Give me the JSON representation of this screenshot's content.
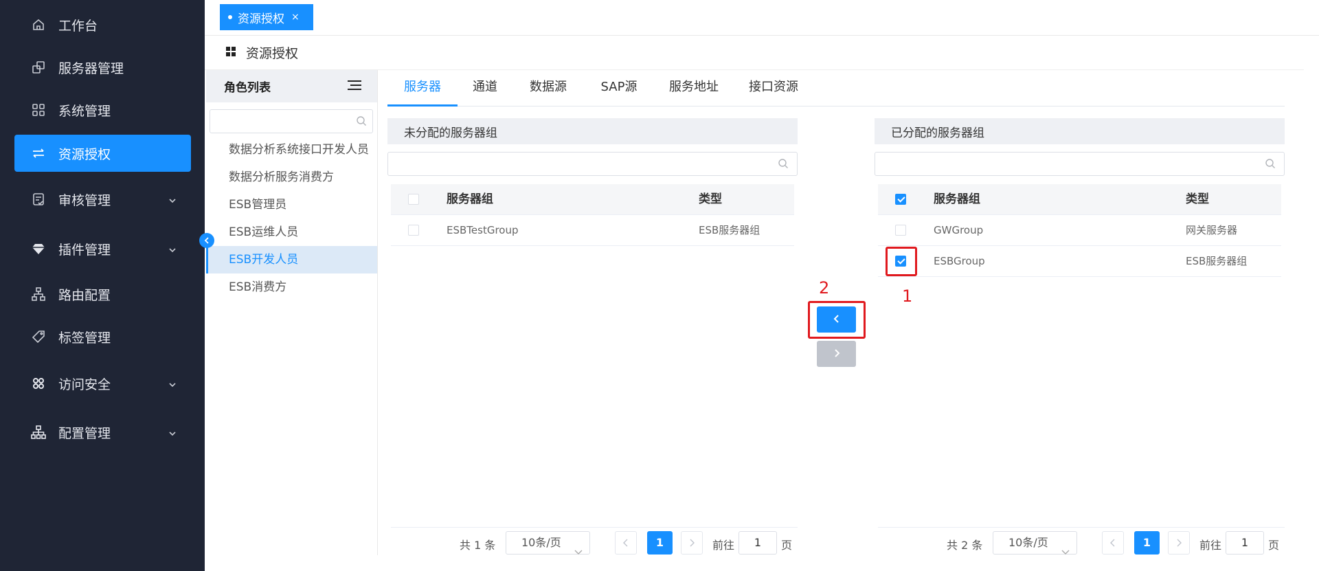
{
  "sidebar": {
    "items": [
      {
        "label": "工作台",
        "icon": "home-icon",
        "has_arrow": false,
        "active": false
      },
      {
        "label": "服务器管理",
        "icon": "server-icon",
        "has_arrow": false,
        "active": false
      },
      {
        "label": "系统管理",
        "icon": "apps-icon",
        "has_arrow": false,
        "active": false
      },
      {
        "label": "资源授权",
        "icon": "transfer-icon",
        "has_arrow": false,
        "active": true
      },
      {
        "label": "审核管理",
        "icon": "audit-icon",
        "has_arrow": true,
        "active": false
      },
      {
        "label": "插件管理",
        "icon": "diamond-icon",
        "has_arrow": true,
        "active": false
      },
      {
        "label": "路由配置",
        "icon": "route-icon",
        "has_arrow": false,
        "active": false
      },
      {
        "label": "标签管理",
        "icon": "tag-icon",
        "has_arrow": false,
        "active": false
      },
      {
        "label": "访问安全",
        "icon": "security-icon",
        "has_arrow": true,
        "active": false
      },
      {
        "label": "配置管理",
        "icon": "config-icon",
        "has_arrow": true,
        "active": false
      }
    ]
  },
  "tabbar": {
    "active_tab": "资源授权",
    "close": "×"
  },
  "breadcrumb": {
    "title": "资源授权"
  },
  "roles": {
    "title": "角色列表",
    "search_placeholder": "",
    "items": [
      "数据分析系统接口开发人员",
      "数据分析服务消费方",
      "ESB管理员",
      "ESB运维人员",
      "ESB开发人员",
      "ESB消费方"
    ],
    "selected_index": 4
  },
  "content_tabs": [
    "服务器",
    "通道",
    "数据源",
    "SAP源",
    "服务地址",
    "接口资源"
  ],
  "left_panel": {
    "title": "未分配的服务器组",
    "search_placeholder": "",
    "columns": [
      "服务器组",
      "类型"
    ],
    "rows": [
      {
        "name": "ESBTestGroup",
        "type": "ESB服务器组",
        "checked": false
      }
    ],
    "header_checked": false,
    "pager": {
      "total": "共 1 条",
      "page_size": "10条/页",
      "current": "1",
      "goto_label": "前往",
      "goto_value": "1",
      "page_unit": "页"
    }
  },
  "right_panel": {
    "title": "已分配的服务器组",
    "search_placeholder": "",
    "columns": [
      "服务器组",
      "类型"
    ],
    "rows": [
      {
        "name": "GWGroup",
        "type": "网关服务器",
        "checked": false
      },
      {
        "name": "ESBGroup",
        "type": "ESB服务器组",
        "checked": true
      }
    ],
    "header_checked": true,
    "pager": {
      "total": "共 2 条",
      "page_size": "10条/页",
      "current": "1",
      "goto_label": "前往",
      "goto_value": "1",
      "page_unit": "页"
    }
  },
  "annotations": {
    "step1": "1",
    "step2": "2"
  },
  "colors": {
    "sidebar_bg": "#1f2535",
    "accent": "#1890ff",
    "annotation": "#e0191e",
    "disabled_btn": "#c0c4cc"
  }
}
